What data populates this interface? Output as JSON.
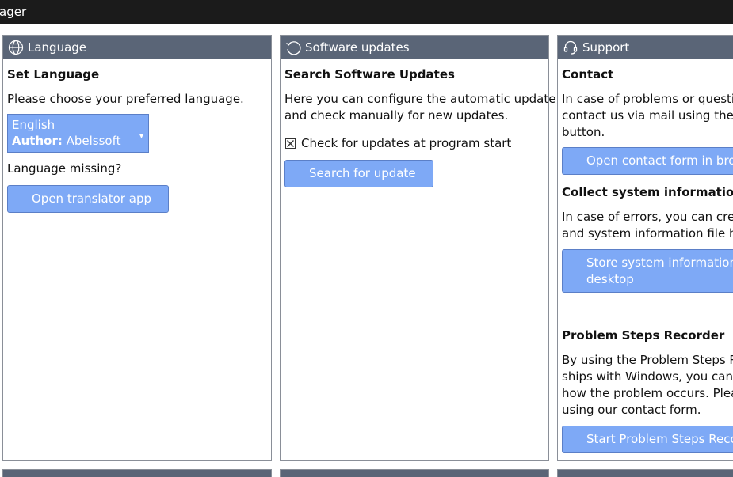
{
  "window": {
    "title": "ager"
  },
  "language": {
    "header": "Language",
    "heading": "Set Language",
    "prompt": "Please choose your preferred language.",
    "selected_language": "English",
    "author_label": "Author:",
    "author_value": "Abelssoft",
    "missing_label": "Language missing?",
    "translator_button": "Open translator app"
  },
  "updates": {
    "header": "Software updates",
    "heading": "Search Software Updates",
    "desc_line1": "Here you can configure the automatic update,",
    "desc_line2": "and check manually for new updates.",
    "checkbox_label": "Check for updates at program start",
    "search_button": "Search for update"
  },
  "support": {
    "header": "Support",
    "contact_heading": "Contact",
    "contact_line1": "In case of problems or questio",
    "contact_line2": "contact us via mail using the co",
    "contact_line3": "button.",
    "contact_button": "Open contact form in brow",
    "collect_heading": "Collect system information",
    "collect_line1": "In case of errors, you can creat",
    "collect_line2": "and system information file her",
    "store_button_line1": "Store system information o",
    "store_button_line2": "desktop",
    "psr_heading": "Problem Steps Recorder",
    "psr_line1": "By using the Problem Steps Rec",
    "psr_line2": "ships with Windows, you can sh",
    "psr_line3": "how the problem occurs. Pleas",
    "psr_line4": "using our contact form.",
    "psr_button": "Start Problem Steps Recor"
  }
}
